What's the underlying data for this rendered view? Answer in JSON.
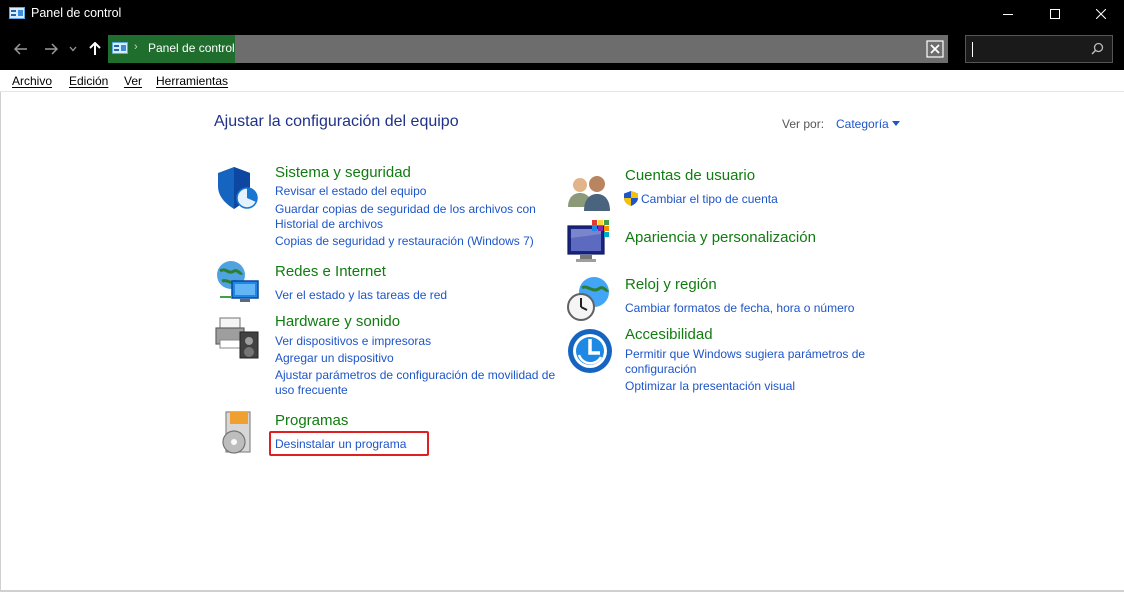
{
  "window": {
    "title": "Panel de control",
    "controls": {
      "minimize": "minimize",
      "maximize": "maximize",
      "close": "close"
    }
  },
  "address_bar": {
    "breadcrumb": "Panel de control",
    "search_placeholder": ""
  },
  "menu": {
    "items": [
      {
        "label": "Archivo"
      },
      {
        "label": "Edición"
      },
      {
        "label": "Ver"
      },
      {
        "label": "Herramientas"
      }
    ]
  },
  "main": {
    "heading": "Ajustar la configuración del equipo",
    "view_by_label": "Ver por:",
    "view_by_value": "Categoría",
    "left_categories": [
      {
        "title": "Sistema y seguridad",
        "icon": "shield-icon",
        "links": [
          "Revisar el estado del equipo",
          "Guardar copias de seguridad de los archivos con",
          "Historial de archivos",
          "Copias de seguridad y restauración (Windows 7)"
        ]
      },
      {
        "title": "Redes e Internet",
        "icon": "network-globe-icon",
        "links": [
          "Ver el estado y las tareas de red"
        ]
      },
      {
        "title": "Hardware y sonido",
        "icon": "printer-speaker-icon",
        "links": [
          "Ver dispositivos e impresoras",
          "Agregar un dispositivo",
          "Ajustar parámetros de configuración de movilidad de",
          "uso frecuente"
        ]
      },
      {
        "title": "Programas",
        "icon": "programs-disc-icon",
        "links": [
          "Desinstalar un programa"
        ]
      }
    ],
    "right_categories": [
      {
        "title": "Cuentas de usuario",
        "icon": "users-icon",
        "links": [
          "Cambiar el tipo de cuenta"
        ]
      },
      {
        "title": "Apariencia y personalización",
        "icon": "monitor-palette-icon",
        "links": []
      },
      {
        "title": "Reloj y región",
        "icon": "clock-globe-icon",
        "links": [
          "Cambiar formatos de fecha, hora o número"
        ]
      },
      {
        "title": "Accesibilidad",
        "icon": "accessibility-icon",
        "links": [
          "Permitir que Windows sugiera parámetros de",
          "configuración",
          "Optimizar la presentación visual"
        ]
      }
    ]
  },
  "colors": {
    "link": "#1e55c9",
    "category_title": "#107c10",
    "heading": "#1e3287",
    "highlight": "#e02020"
  }
}
